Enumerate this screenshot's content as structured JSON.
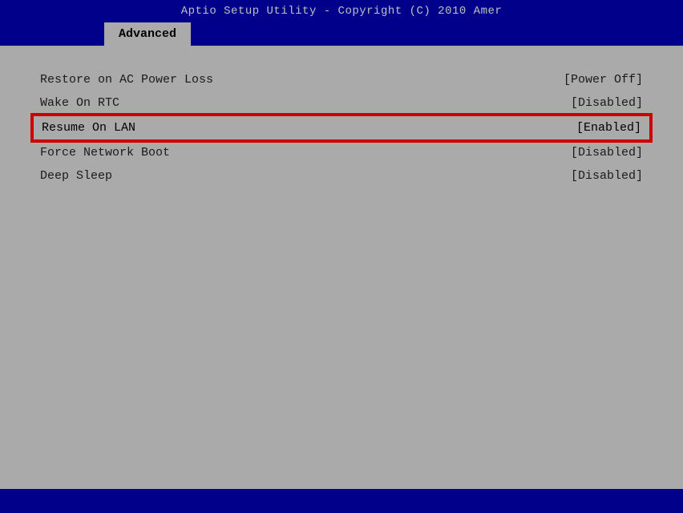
{
  "titleBar": {
    "text": "Aptio Setup Utility - Copyright (C) 2010 Amer"
  },
  "tabs": [
    {
      "label": "Advanced",
      "active": true
    }
  ],
  "menuItems": [
    {
      "label": "Restore on AC Power Loss",
      "value": "[Power Off]",
      "selected": false
    },
    {
      "label": "Wake On RTC",
      "value": "[Disabled]",
      "selected": false
    },
    {
      "label": "Resume On LAN",
      "value": "[Enabled]",
      "selected": true
    },
    {
      "label": "Force Network Boot",
      "value": "[Disabled]",
      "selected": false
    },
    {
      "label": "Deep Sleep",
      "value": "[Disabled]",
      "selected": false
    }
  ]
}
